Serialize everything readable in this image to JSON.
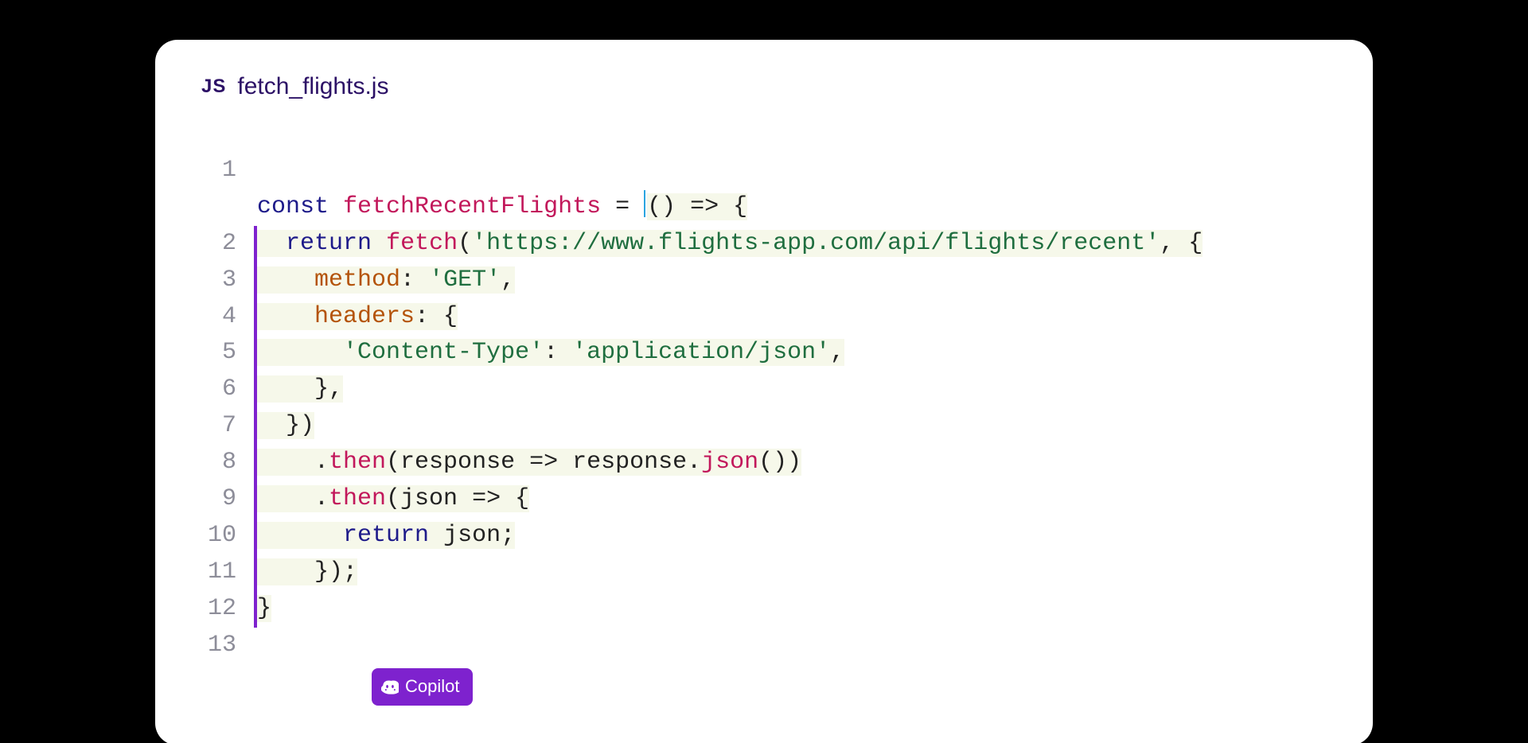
{
  "tab": {
    "lang_badge": "JS",
    "filename": "fetch_flights.js"
  },
  "gutter": [
    "1",
    "2",
    "3",
    "4",
    "5",
    "6",
    "7",
    "8",
    "9",
    "10",
    "11",
    "12",
    "13"
  ],
  "code": {
    "l1_const": "const",
    "l1_fname": "fetchRecentFlights",
    "l1_eq": " = ",
    "l1_arrow": "() => {",
    "l2_return": "return",
    "l2_fetch": "fetch",
    "l2_open": "(",
    "l2_url": "'https://www.flights-app.com/api/flights/recent'",
    "l2_after": ", {",
    "l3_method": "method",
    "l3_colon": ": ",
    "l3_val": "'GET'",
    "l3_comma": ",",
    "l4_headers": "headers",
    "l4_rest": ": {",
    "l5_ct": "'Content-Type'",
    "l5_sep": ": ",
    "l5_val": "'application/json'",
    "l5_comma": ",",
    "l6": "},",
    "l7": "})",
    "l8_dot": ".",
    "l8_then": "then",
    "l8_open": "(response => response.",
    "l8_json": "json",
    "l8_close": "())",
    "l9_dot": ".",
    "l9_then": "then",
    "l9_rest": "(json => {",
    "l10_return": "return",
    "l10_rest": " json;",
    "l11": "});",
    "l12": "}"
  },
  "copilot": {
    "label": "Copilot"
  }
}
